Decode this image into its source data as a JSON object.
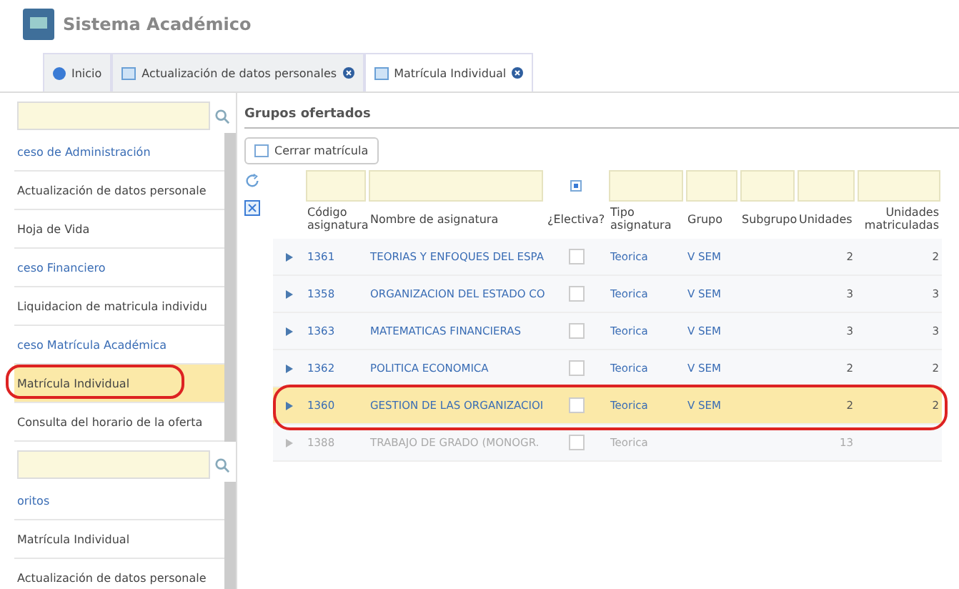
{
  "header": {
    "title": "Sistema Académico"
  },
  "tabs": [
    {
      "label": "Inicio",
      "kind": "home",
      "closable": false,
      "selected": false
    },
    {
      "label": "Actualización de datos personales",
      "kind": "page",
      "closable": true,
      "selected": false
    },
    {
      "label": "Matrícula Individual",
      "kind": "page",
      "closable": true,
      "selected": true
    }
  ],
  "sidebar": {
    "menu": [
      {
        "kind": "group",
        "label": "ceso de Administración",
        "selected": false,
        "circled": false
      },
      {
        "kind": "item",
        "label": "Actualización de datos personale",
        "selected": false,
        "circled": false
      },
      {
        "kind": "item",
        "label": "Hoja de Vida",
        "selected": false,
        "circled": false
      },
      {
        "kind": "group",
        "label": "ceso Financiero",
        "selected": false,
        "circled": false
      },
      {
        "kind": "item",
        "label": "Liquidacion de matricula individu",
        "selected": false,
        "circled": false
      },
      {
        "kind": "group",
        "label": "ceso Matrícula Académica",
        "selected": false,
        "circled": false
      },
      {
        "kind": "item",
        "label": "Matrícula Individual",
        "selected": true,
        "circled": true
      },
      {
        "kind": "item",
        "label": "Consulta del horario de la oferta",
        "selected": false,
        "circled": false
      }
    ],
    "favorites": [
      {
        "kind": "group",
        "label": "oritos",
        "selected": false,
        "circled": false
      },
      {
        "kind": "item",
        "label": "Matrícula Individual",
        "selected": false,
        "circled": false
      },
      {
        "kind": "item",
        "label": "Actualización de datos personale",
        "selected": false,
        "circled": false
      }
    ]
  },
  "section_title": "Grupos ofertados",
  "close_button": "Cerrar matrícula",
  "table": {
    "filter_checked": true,
    "columns": [
      "Código asignatura",
      "Nombre de asignatura",
      "¿Electiva?",
      "Tipo asignatura",
      "Grupo",
      "Subgrupo",
      "Unidades",
      "Unidades matriculadas"
    ],
    "rows": [
      {
        "cells": [
          "1361",
          "TEORIAS Y ENFOQUES DEL ESPA",
          "",
          "Teorica",
          "V SEM",
          "",
          "2",
          "2"
        ],
        "checked": false,
        "selected": false,
        "disabled": false,
        "circled": false
      },
      {
        "cells": [
          "1358",
          "ORGANIZACION DEL ESTADO CO",
          "",
          "Teorica",
          "V SEM",
          "",
          "3",
          "3"
        ],
        "checked": false,
        "selected": false,
        "disabled": false,
        "circled": false
      },
      {
        "cells": [
          "1363",
          "MATEMATICAS FINANCIERAS",
          "",
          "Teorica",
          "V SEM",
          "",
          "3",
          "3"
        ],
        "checked": false,
        "selected": false,
        "disabled": false,
        "circled": false
      },
      {
        "cells": [
          "1362",
          "POLITICA ECONOMICA",
          "",
          "Teorica",
          "V SEM",
          "",
          "2",
          "2"
        ],
        "checked": false,
        "selected": false,
        "disabled": false,
        "circled": false
      },
      {
        "cells": [
          "1360",
          "GESTION DE LAS ORGANIZACIOI",
          "",
          "Teorica",
          "V SEM",
          "",
          "2",
          "2"
        ],
        "checked": false,
        "selected": true,
        "disabled": false,
        "circled": true
      },
      {
        "cells": [
          "1388",
          "TRABAJO DE GRADO (MONOGR.",
          "",
          "Teorica",
          "",
          "",
          "13",
          ""
        ],
        "checked": false,
        "selected": false,
        "disabled": true,
        "circled": false
      }
    ]
  }
}
